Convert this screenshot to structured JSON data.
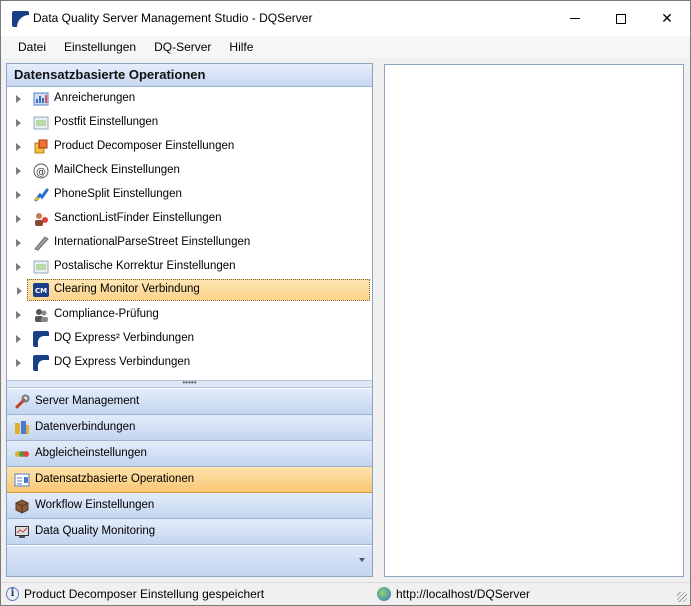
{
  "window": {
    "title": "Data Quality Server Management Studio - DQServer",
    "min_glyph": "",
    "close_glyph": "✕"
  },
  "menu": [
    "Datei",
    "Einstellungen",
    "DQ-Server",
    "Hilfe"
  ],
  "left_panel": {
    "header": "Datensatzbasierte Operationen",
    "tree_items": [
      {
        "label": "Anreicherungen",
        "icon": "enrichment-icon"
      },
      {
        "label": "Postfit Einstellungen",
        "icon": "postfit-icon"
      },
      {
        "label": "Product Decomposer Einstellungen",
        "icon": "product-decomposer-icon"
      },
      {
        "label": "MailCheck Einstellungen",
        "icon": "mailcheck-icon"
      },
      {
        "label": "PhoneSplit Einstellungen",
        "icon": "phonesplit-icon"
      },
      {
        "label": "SanctionListFinder Einstellungen",
        "icon": "sanction-list-icon"
      },
      {
        "label": "InternationalParseStreet Einstellungen",
        "icon": "parse-street-icon"
      },
      {
        "label": "Postalische Korrektur Einstellungen",
        "icon": "postal-correction-icon"
      },
      {
        "label": "Clearing Monitor Verbindung",
        "icon": "clearing-monitor-icon",
        "selected": true
      },
      {
        "label": "Compliance-Prüfung",
        "icon": "compliance-icon"
      },
      {
        "label": "DQ Express² Verbindungen",
        "icon": "dq-express2-icon"
      },
      {
        "label": "DQ Express Verbindungen",
        "icon": "dq-express-icon"
      }
    ],
    "splitter_glyph": "•••••",
    "nav_buttons": [
      {
        "label": "Server Management",
        "icon": "wrench-icon"
      },
      {
        "label": "Datenverbindungen",
        "icon": "data-connections-icon"
      },
      {
        "label": "Abgleicheinstellungen",
        "icon": "matching-icon"
      },
      {
        "label": "Datensatzbasierte Operationen",
        "icon": "record-operations-icon",
        "active": true
      },
      {
        "label": "Workflow Einstellungen",
        "icon": "workflow-icon"
      },
      {
        "label": "Data Quality Monitoring",
        "icon": "monitoring-icon"
      }
    ]
  },
  "status": {
    "message": "Product Decomposer Einstellung gespeichert",
    "info_glyph": "i",
    "url": "http://localhost/DQServer"
  }
}
